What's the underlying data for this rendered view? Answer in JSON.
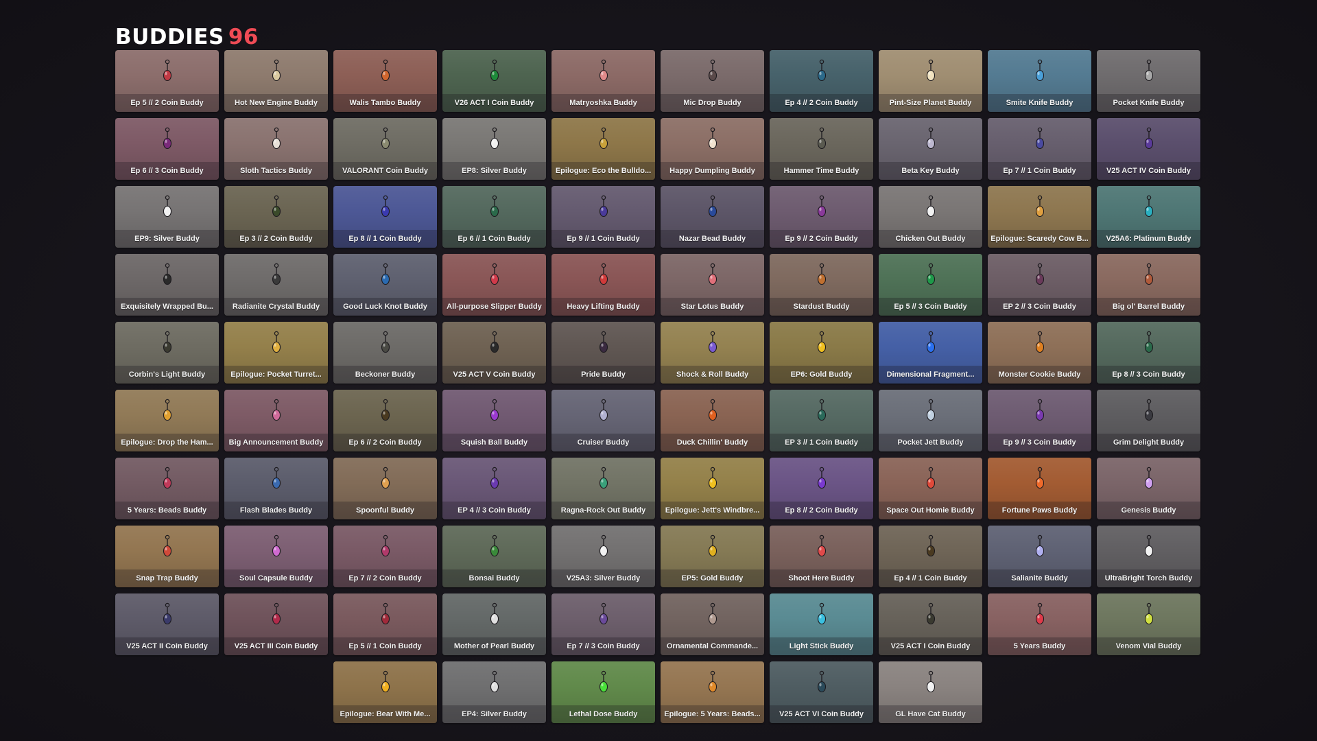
{
  "header": {
    "title": "BUDDIES",
    "count": "96"
  },
  "buddies": [
    {
      "name": "Ep 5 // 2 Coin Buddy",
      "bg": "#8c6e6c",
      "charm": "#c03a44"
    },
    {
      "name": "Hot New Engine Buddy",
      "bg": "#8e7b6e",
      "charm": "#d9c9a0"
    },
    {
      "name": "Walis Tambo Buddy",
      "bg": "#8d5f56",
      "charm": "#d0662f"
    },
    {
      "name": "V26 ACT I Coin Buddy",
      "bg": "#4e6450",
      "charm": "#1e8a3a"
    },
    {
      "name": "Matryoshka Buddy",
      "bg": "#8c6a66",
      "charm": "#e08a8a"
    },
    {
      "name": "Mic Drop Buddy",
      "bg": "#7b6b6b",
      "charm": "#5a4a4a"
    },
    {
      "name": "Ep 4 // 2 Coin Buddy",
      "bg": "#47626b",
      "charm": "#2c6a8a"
    },
    {
      "name": "Pint-Size Planet Buddy",
      "bg": "#a08e72",
      "charm": "#f1e3c0"
    },
    {
      "name": "Smite Knife Buddy",
      "bg": "#547b92",
      "charm": "#4aa0d9"
    },
    {
      "name": "Pocket Knife Buddy",
      "bg": "#6f6c6e",
      "charm": "#a8a8a8"
    },
    {
      "name": "Ep 6 // 3 Coin Buddy",
      "bg": "#7e5a66",
      "charm": "#7a2a7a"
    },
    {
      "name": "Sloth Tactics Buddy",
      "bg": "#8a7370",
      "charm": "#e8e0d8"
    },
    {
      "name": "VALORANT Coin Buddy",
      "bg": "#6f6d64",
      "charm": "#8a8a70"
    },
    {
      "name": "EP8: Silver Buddy",
      "bg": "#7a7875",
      "charm": "#f1f1f1"
    },
    {
      "name": "Epilogue: Eco the Bulldo...",
      "bg": "#8e7749",
      "charm": "#c9a23a"
    },
    {
      "name": "Happy Dumpling Buddy",
      "bg": "#8c6f66",
      "charm": "#f1e3d0"
    },
    {
      "name": "Hammer Time Buddy",
      "bg": "#6b675d",
      "charm": "#5a5a50"
    },
    {
      "name": "Beta Key Buddy",
      "bg": "#6a6570",
      "charm": "#bdb8d0"
    },
    {
      "name": "Ep 7 // 1 Coin Buddy",
      "bg": "#675f6e",
      "charm": "#4a4aa0"
    },
    {
      "name": "V25 ACT IV Coin Buddy",
      "bg": "#5b4f6d",
      "charm": "#5a3a9a"
    },
    {
      "name": "EP9: Silver Buddy",
      "bg": "#777474",
      "charm": "#f1f1f1"
    },
    {
      "name": "Ep 3 // 2 Coin Buddy",
      "bg": "#6b6553",
      "charm": "#3a4a2a"
    },
    {
      "name": "Ep 8 // 1 Coin Buddy",
      "bg": "#4d5896",
      "charm": "#3a3ab0"
    },
    {
      "name": "Ep 6 // 1 Coin Buddy",
      "bg": "#54695e",
      "charm": "#2a6a4a"
    },
    {
      "name": "Ep 9 // 1 Coin Buddy",
      "bg": "#655b70",
      "charm": "#4a3a9a"
    },
    {
      "name": "Nazar Bead Buddy",
      "bg": "#5d5668",
      "charm": "#2a4a9a"
    },
    {
      "name": "Ep 9 // 2 Coin Buddy",
      "bg": "#6e5c70",
      "charm": "#8a3a9a"
    },
    {
      "name": "Chicken Out Buddy",
      "bg": "#7a7675",
      "charm": "#f1f1f1"
    },
    {
      "name": "Epilogue: Scaredy Cow B...",
      "bg": "#8e7750",
      "charm": "#e0a040"
    },
    {
      "name": "V25A6: Platinum Buddy",
      "bg": "#4f7775",
      "charm": "#2ab0c0"
    },
    {
      "name": "Exquisitely Wrapped Bu...",
      "bg": "#6d6868",
      "charm": "#2a2a2a"
    },
    {
      "name": "Radianite Crystal Buddy",
      "bg": "#6f6c6b",
      "charm": "#3a3a3a"
    },
    {
      "name": "Good Luck Knot Buddy",
      "bg": "#5f6170",
      "charm": "#2a6ab0"
    },
    {
      "name": "All-purpose Slipper Buddy",
      "bg": "#8a5757",
      "charm": "#d03a4a"
    },
    {
      "name": "Heavy Lifting Buddy",
      "bg": "#8a5656",
      "charm": "#d03a3a"
    },
    {
      "name": "Star Lotus Buddy",
      "bg": "#7d6767",
      "charm": "#e0707a"
    },
    {
      "name": "Stardust Buddy",
      "bg": "#7f6a5f",
      "charm": "#c07030"
    },
    {
      "name": "Ep 5 // 3 Coin Buddy",
      "bg": "#4f7257",
      "charm": "#1e9a4a"
    },
    {
      "name": "EP 2 // 3 Coin Buddy",
      "bg": "#6d5e66",
      "charm": "#6a3a5a"
    },
    {
      "name": "Big ol' Barrel Buddy",
      "bg": "#8a6a60",
      "charm": "#b05a3a"
    },
    {
      "name": "Corbin's Light Buddy",
      "bg": "#6e6c62",
      "charm": "#3a3a30"
    },
    {
      "name": "Epilogue: Pocket Turret...",
      "bg": "#94804b",
      "charm": "#e0b040"
    },
    {
      "name": "Beckoner Buddy",
      "bg": "#6d6b68",
      "charm": "#4a4a44"
    },
    {
      "name": "V25 ACT V Coin Buddy",
      "bg": "#6f6253",
      "charm": "#2a2a2a"
    },
    {
      "name": "Pride Buddy",
      "bg": "#605753",
      "charm": "#3a2a40"
    },
    {
      "name": "Shock & Roll Buddy",
      "bg": "#948251",
      "charm": "#7a5ad0"
    },
    {
      "name": "EP6: Gold Buddy",
      "bg": "#8a7a48",
      "charm": "#f0c020"
    },
    {
      "name": "Dimensional Fragment...",
      "bg": "#4560a6",
      "charm": "#2a70f0"
    },
    {
      "name": "Monster Cookie Buddy",
      "bg": "#8e7058",
      "charm": "#e08020"
    },
    {
      "name": "Ep 8 // 3 Coin Buddy",
      "bg": "#556a5e",
      "charm": "#2a6a4a"
    },
    {
      "name": "Epilogue: Drop the Ham...",
      "bg": "#917a57",
      "charm": "#e0a030"
    },
    {
      "name": "Big Announcement Buddy",
      "bg": "#7e5b66",
      "charm": "#d06a9a"
    },
    {
      "name": "Ep 6 // 2 Coin Buddy",
      "bg": "#6c6550",
      "charm": "#4a3a20"
    },
    {
      "name": "Squish Ball Buddy",
      "bg": "#715a72",
      "charm": "#9a3ad0"
    },
    {
      "name": "Cruiser Buddy",
      "bg": "#666575",
      "charm": "#b0b0d0"
    },
    {
      "name": "Duck Chillin' Buddy",
      "bg": "#8a6453",
      "charm": "#e06020"
    },
    {
      "name": "EP 3 // 1 Coin Buddy",
      "bg": "#566a63",
      "charm": "#2a6a5a"
    },
    {
      "name": "Pocket Jett Buddy",
      "bg": "#6b6f79",
      "charm": "#c0d0e0"
    },
    {
      "name": "Ep 9 // 3 Coin Buddy",
      "bg": "#6e5c72",
      "charm": "#7a3ab0"
    },
    {
      "name": "Grim Delight Buddy",
      "bg": "#5e5d60",
      "charm": "#3a3a40"
    },
    {
      "name": "5 Years: Beads Buddy",
      "bg": "#735b63",
      "charm": "#c03a5a"
    },
    {
      "name": "Flash Blades Buddy",
      "bg": "#5c5d6c",
      "charm": "#3a6ab0"
    },
    {
      "name": "Spoonful Buddy",
      "bg": "#826c58",
      "charm": "#e0a050"
    },
    {
      "name": "EP 4 // 3 Coin Buddy",
      "bg": "#6a5877",
      "charm": "#6a3ab0"
    },
    {
      "name": "Ragna-Rock Out Buddy",
      "bg": "#727466",
      "charm": "#3aa07a"
    },
    {
      "name": "Epilogue: Jett's Windbre...",
      "bg": "#94814a",
      "charm": "#f0c020"
    },
    {
      "name": "Ep 8 // 2 Coin Buddy",
      "bg": "#6b5586",
      "charm": "#7a3ad0"
    },
    {
      "name": "Space Out Homie Buddy",
      "bg": "#8a6458",
      "charm": "#e04a3a"
    },
    {
      "name": "Fortune Paws Buddy",
      "bg": "#a35c33",
      "charm": "#f06a2a"
    },
    {
      "name": "Genesis Buddy",
      "bg": "#7b6569",
      "charm": "#d0a0f0"
    },
    {
      "name": "Snap Trap Buddy",
      "bg": "#937651",
      "charm": "#d04a3a"
    },
    {
      "name": "Soul Capsule Buddy",
      "bg": "#7d5f73",
      "charm": "#d06ad0"
    },
    {
      "name": "Ep 7 // 2 Coin Buddy",
      "bg": "#7a5a66",
      "charm": "#b03a6a"
    },
    {
      "name": "Bonsai Buddy",
      "bg": "#5f6a59",
      "charm": "#3a8a3a"
    },
    {
      "name": "V25A3: Silver Buddy",
      "bg": "#737171",
      "charm": "#f1f1f1"
    },
    {
      "name": "EP5: Gold Buddy",
      "bg": "#857a55",
      "charm": "#e0b020"
    },
    {
      "name": "Shoot Here Buddy",
      "bg": "#7a615c",
      "charm": "#e04a4a"
    },
    {
      "name": "Ep 4 // 1 Coin Buddy",
      "bg": "#6f6557",
      "charm": "#4a3a20"
    },
    {
      "name": "Salianite Buddy",
      "bg": "#5f6274",
      "charm": "#b0b0f0"
    },
    {
      "name": "UltraBright Torch Buddy",
      "bg": "#615f62",
      "charm": "#f1f1f1"
    },
    {
      "name": "V25 ACT II Coin Buddy",
      "bg": "#5e5b69",
      "charm": "#3a3a6a"
    },
    {
      "name": "V25 ACT III Coin Buddy",
      "bg": "#6f535b",
      "charm": "#b02a4a"
    },
    {
      "name": "Ep 5 // 1 Coin Buddy",
      "bg": "#7a5a5e",
      "charm": "#a02a3a"
    },
    {
      "name": "Mother of Pearl Buddy",
      "bg": "#646968",
      "charm": "#e0e0e0"
    },
    {
      "name": "Ep 7 // 3 Coin Buddy",
      "bg": "#6d5f6c",
      "charm": "#6a4a9a"
    },
    {
      "name": "Ornamental Commande...",
      "bg": "#726460",
      "charm": "#b09a90"
    },
    {
      "name": "Light Stick Buddy",
      "bg": "#5a8b93",
      "charm": "#3ac0e0"
    },
    {
      "name": "V25 ACT I Coin Buddy",
      "bg": "#67625a",
      "charm": "#3a3a30"
    },
    {
      "name": "5 Years Buddy",
      "bg": "#886262",
      "charm": "#e03a4a"
    },
    {
      "name": "Venom Vial Buddy",
      "bg": "#6e775f",
      "charm": "#d0e040"
    },
    {
      "name": "Epilogue: Bear With Me...",
      "bg": "#8e734b",
      "charm": "#f0b020"
    },
    {
      "name": "EP4: Silver Buddy",
      "bg": "#6f6f70",
      "charm": "#e0e0e0"
    },
    {
      "name": "Lethal Dose Buddy",
      "bg": "#618a4b",
      "charm": "#4ae03a"
    },
    {
      "name": "Epilogue: 5 Years: Beads...",
      "bg": "#957652",
      "charm": "#e08a2a"
    },
    {
      "name": "V25 ACT VI Coin Buddy",
      "bg": "#4f5d62",
      "charm": "#2a4a5a"
    },
    {
      "name": "GL Have Cat Buddy",
      "bg": "#8a8380",
      "charm": "#f1f1f1"
    }
  ]
}
